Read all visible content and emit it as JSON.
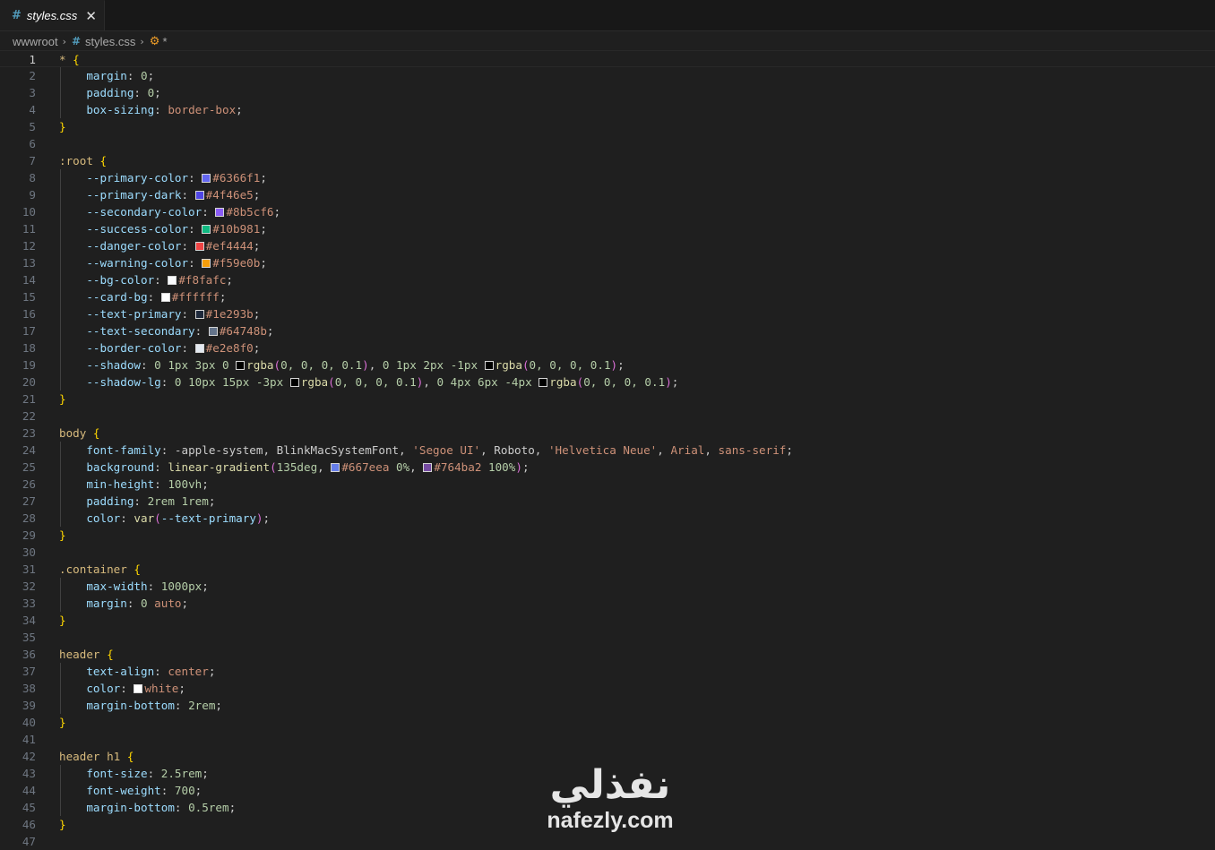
{
  "tab": {
    "icon": "css-hash-icon",
    "icon_glyph": "#",
    "label": "styles.css",
    "close_glyph": "✕"
  },
  "breadcrumb": {
    "items": [
      "wwwroot",
      "styles.css"
    ],
    "separator": "›",
    "file_icon_glyph": "#",
    "symbol_icon_glyph": "⚙",
    "symbol_label": "*"
  },
  "editor": {
    "current_line": 1,
    "lines": [
      [
        [
          "sel",
          "* "
        ],
        [
          "br",
          "{"
        ]
      ],
      [
        [
          "prop",
          "    margin"
        ],
        [
          "pun",
          ": "
        ],
        [
          "num",
          "0"
        ],
        [
          "pun",
          ";"
        ]
      ],
      [
        [
          "prop",
          "    padding"
        ],
        [
          "pun",
          ": "
        ],
        [
          "num",
          "0"
        ],
        [
          "pun",
          ";"
        ]
      ],
      [
        [
          "prop",
          "    box-sizing"
        ],
        [
          "pun",
          ": "
        ],
        [
          "val",
          "border-box"
        ],
        [
          "pun",
          ";"
        ]
      ],
      [
        [
          "br",
          "}"
        ]
      ],
      [],
      [
        [
          "sel",
          ":root "
        ],
        [
          "br",
          "{"
        ]
      ],
      [
        [
          "prop",
          "    --primary-color"
        ],
        [
          "pun",
          ": "
        ],
        [
          "sw",
          "#6366f1"
        ],
        [
          "val",
          "#6366f1"
        ],
        [
          "pun",
          ";"
        ]
      ],
      [
        [
          "prop",
          "    --primary-dark"
        ],
        [
          "pun",
          ": "
        ],
        [
          "sw",
          "#4f46e5"
        ],
        [
          "val",
          "#4f46e5"
        ],
        [
          "pun",
          ";"
        ]
      ],
      [
        [
          "prop",
          "    --secondary-color"
        ],
        [
          "pun",
          ": "
        ],
        [
          "sw",
          "#8b5cf6"
        ],
        [
          "val",
          "#8b5cf6"
        ],
        [
          "pun",
          ";"
        ]
      ],
      [
        [
          "prop",
          "    --success-color"
        ],
        [
          "pun",
          ": "
        ],
        [
          "sw",
          "#10b981"
        ],
        [
          "val",
          "#10b981"
        ],
        [
          "pun",
          ";"
        ]
      ],
      [
        [
          "prop",
          "    --danger-color"
        ],
        [
          "pun",
          ": "
        ],
        [
          "sw",
          "#ef4444"
        ],
        [
          "val",
          "#ef4444"
        ],
        [
          "pun",
          ";"
        ]
      ],
      [
        [
          "prop",
          "    --warning-color"
        ],
        [
          "pun",
          ": "
        ],
        [
          "sw",
          "#f59e0b"
        ],
        [
          "val",
          "#f59e0b"
        ],
        [
          "pun",
          ";"
        ]
      ],
      [
        [
          "prop",
          "    --bg-color"
        ],
        [
          "pun",
          ": "
        ],
        [
          "sw",
          "#f8fafc"
        ],
        [
          "val",
          "#f8fafc"
        ],
        [
          "pun",
          ";"
        ]
      ],
      [
        [
          "prop",
          "    --card-bg"
        ],
        [
          "pun",
          ": "
        ],
        [
          "sw",
          "#ffffff"
        ],
        [
          "val",
          "#ffffff"
        ],
        [
          "pun",
          ";"
        ]
      ],
      [
        [
          "prop",
          "    --text-primary"
        ],
        [
          "pun",
          ": "
        ],
        [
          "sw",
          "#1e293b"
        ],
        [
          "val",
          "#1e293b"
        ],
        [
          "pun",
          ";"
        ]
      ],
      [
        [
          "prop",
          "    --text-secondary"
        ],
        [
          "pun",
          ": "
        ],
        [
          "sw",
          "#64748b"
        ],
        [
          "val",
          "#64748b"
        ],
        [
          "pun",
          ";"
        ]
      ],
      [
        [
          "prop",
          "    --border-color"
        ],
        [
          "pun",
          ": "
        ],
        [
          "sw",
          "#e2e8f0"
        ],
        [
          "val",
          "#e2e8f0"
        ],
        [
          "pun",
          ";"
        ]
      ],
      [
        [
          "prop",
          "    --shadow"
        ],
        [
          "pun",
          ": "
        ],
        [
          "num",
          "0 1px 3px 0 "
        ],
        [
          "sw",
          "#000000"
        ],
        [
          "fn",
          "rgba"
        ],
        [
          "br2",
          "("
        ],
        [
          "num",
          "0, 0, 0, 0.1"
        ],
        [
          "br2",
          ")"
        ],
        [
          "pun",
          ", "
        ],
        [
          "num",
          "0 1px 2px -1px "
        ],
        [
          "sw",
          "#000000"
        ],
        [
          "fn",
          "rgba"
        ],
        [
          "br2",
          "("
        ],
        [
          "num",
          "0, 0, 0, 0.1"
        ],
        [
          "br2",
          ")"
        ],
        [
          "pun",
          ";"
        ]
      ],
      [
        [
          "prop",
          "    --shadow-lg"
        ],
        [
          "pun",
          ": "
        ],
        [
          "num",
          "0 10px 15px -3px "
        ],
        [
          "sw",
          "#000000"
        ],
        [
          "fn",
          "rgba"
        ],
        [
          "br2",
          "("
        ],
        [
          "num",
          "0, 0, 0, 0.1"
        ],
        [
          "br2",
          ")"
        ],
        [
          "pun",
          ", "
        ],
        [
          "num",
          "0 4px 6px -4px "
        ],
        [
          "sw",
          "#000000"
        ],
        [
          "fn",
          "rgba"
        ],
        [
          "br2",
          "("
        ],
        [
          "num",
          "0, 0, 0, 0.1"
        ],
        [
          "br2",
          ")"
        ],
        [
          "pun",
          ";"
        ]
      ],
      [
        [
          "br",
          "}"
        ]
      ],
      [],
      [
        [
          "sel",
          "body "
        ],
        [
          "br",
          "{"
        ]
      ],
      [
        [
          "prop",
          "    font-family"
        ],
        [
          "pun",
          ": "
        ],
        [
          "val2",
          "-apple-system, BlinkMacSystemFont, "
        ],
        [
          "val",
          "'Segoe UI'"
        ],
        [
          "pun",
          ", "
        ],
        [
          "val2",
          "Roboto, "
        ],
        [
          "val",
          "'Helvetica Neue'"
        ],
        [
          "pun",
          ", "
        ],
        [
          "val",
          "Arial"
        ],
        [
          "pun",
          ", "
        ],
        [
          "val",
          "sans-serif"
        ],
        [
          "pun",
          ";"
        ]
      ],
      [
        [
          "prop",
          "    background"
        ],
        [
          "pun",
          ": "
        ],
        [
          "fn",
          "linear-gradient"
        ],
        [
          "br2",
          "("
        ],
        [
          "num",
          "135deg"
        ],
        [
          "pun",
          ", "
        ],
        [
          "sw",
          "#667eea"
        ],
        [
          "val",
          "#667eea "
        ],
        [
          "num",
          "0%"
        ],
        [
          "pun",
          ", "
        ],
        [
          "sw",
          "#764ba2"
        ],
        [
          "val",
          "#764ba2 "
        ],
        [
          "num",
          "100%"
        ],
        [
          "br2",
          ")"
        ],
        [
          "pun",
          ";"
        ]
      ],
      [
        [
          "prop",
          "    min-height"
        ],
        [
          "pun",
          ": "
        ],
        [
          "num",
          "100vh"
        ],
        [
          "pun",
          ";"
        ]
      ],
      [
        [
          "prop",
          "    padding"
        ],
        [
          "pun",
          ": "
        ],
        [
          "num",
          "2rem 1rem"
        ],
        [
          "pun",
          ";"
        ]
      ],
      [
        [
          "prop",
          "    color"
        ],
        [
          "pun",
          ": "
        ],
        [
          "fn",
          "var"
        ],
        [
          "br2",
          "("
        ],
        [
          "prop",
          "--text-primary"
        ],
        [
          "br2",
          ")"
        ],
        [
          "pun",
          ";"
        ]
      ],
      [
        [
          "br",
          "}"
        ]
      ],
      [],
      [
        [
          "sel",
          ".container "
        ],
        [
          "br",
          "{"
        ]
      ],
      [
        [
          "prop",
          "    max-width"
        ],
        [
          "pun",
          ": "
        ],
        [
          "num",
          "1000px"
        ],
        [
          "pun",
          ";"
        ]
      ],
      [
        [
          "prop",
          "    margin"
        ],
        [
          "pun",
          ": "
        ],
        [
          "num",
          "0 "
        ],
        [
          "val",
          "auto"
        ],
        [
          "pun",
          ";"
        ]
      ],
      [
        [
          "br",
          "}"
        ]
      ],
      [],
      [
        [
          "sel",
          "header "
        ],
        [
          "br",
          "{"
        ]
      ],
      [
        [
          "prop",
          "    text-align"
        ],
        [
          "pun",
          ": "
        ],
        [
          "val",
          "center"
        ],
        [
          "pun",
          ";"
        ]
      ],
      [
        [
          "prop",
          "    color"
        ],
        [
          "pun",
          ": "
        ],
        [
          "sw",
          "#ffffff"
        ],
        [
          "val",
          "white"
        ],
        [
          "pun",
          ";"
        ]
      ],
      [
        [
          "prop",
          "    margin-bottom"
        ],
        [
          "pun",
          ": "
        ],
        [
          "num",
          "2rem"
        ],
        [
          "pun",
          ";"
        ]
      ],
      [
        [
          "br",
          "}"
        ]
      ],
      [],
      [
        [
          "sel",
          "header h1 "
        ],
        [
          "br",
          "{"
        ]
      ],
      [
        [
          "prop",
          "    font-size"
        ],
        [
          "pun",
          ": "
        ],
        [
          "num",
          "2.5rem"
        ],
        [
          "pun",
          ";"
        ]
      ],
      [
        [
          "prop",
          "    font-weight"
        ],
        [
          "pun",
          ": "
        ],
        [
          "num",
          "700"
        ],
        [
          "pun",
          ";"
        ]
      ],
      [
        [
          "prop",
          "    margin-bottom"
        ],
        [
          "pun",
          ": "
        ],
        [
          "num",
          "0.5rem"
        ],
        [
          "pun",
          ";"
        ]
      ],
      [
        [
          "br",
          "}"
        ]
      ],
      []
    ]
  },
  "watermark": {
    "arabic": "نفذلي",
    "latin": "nafezly.com"
  }
}
